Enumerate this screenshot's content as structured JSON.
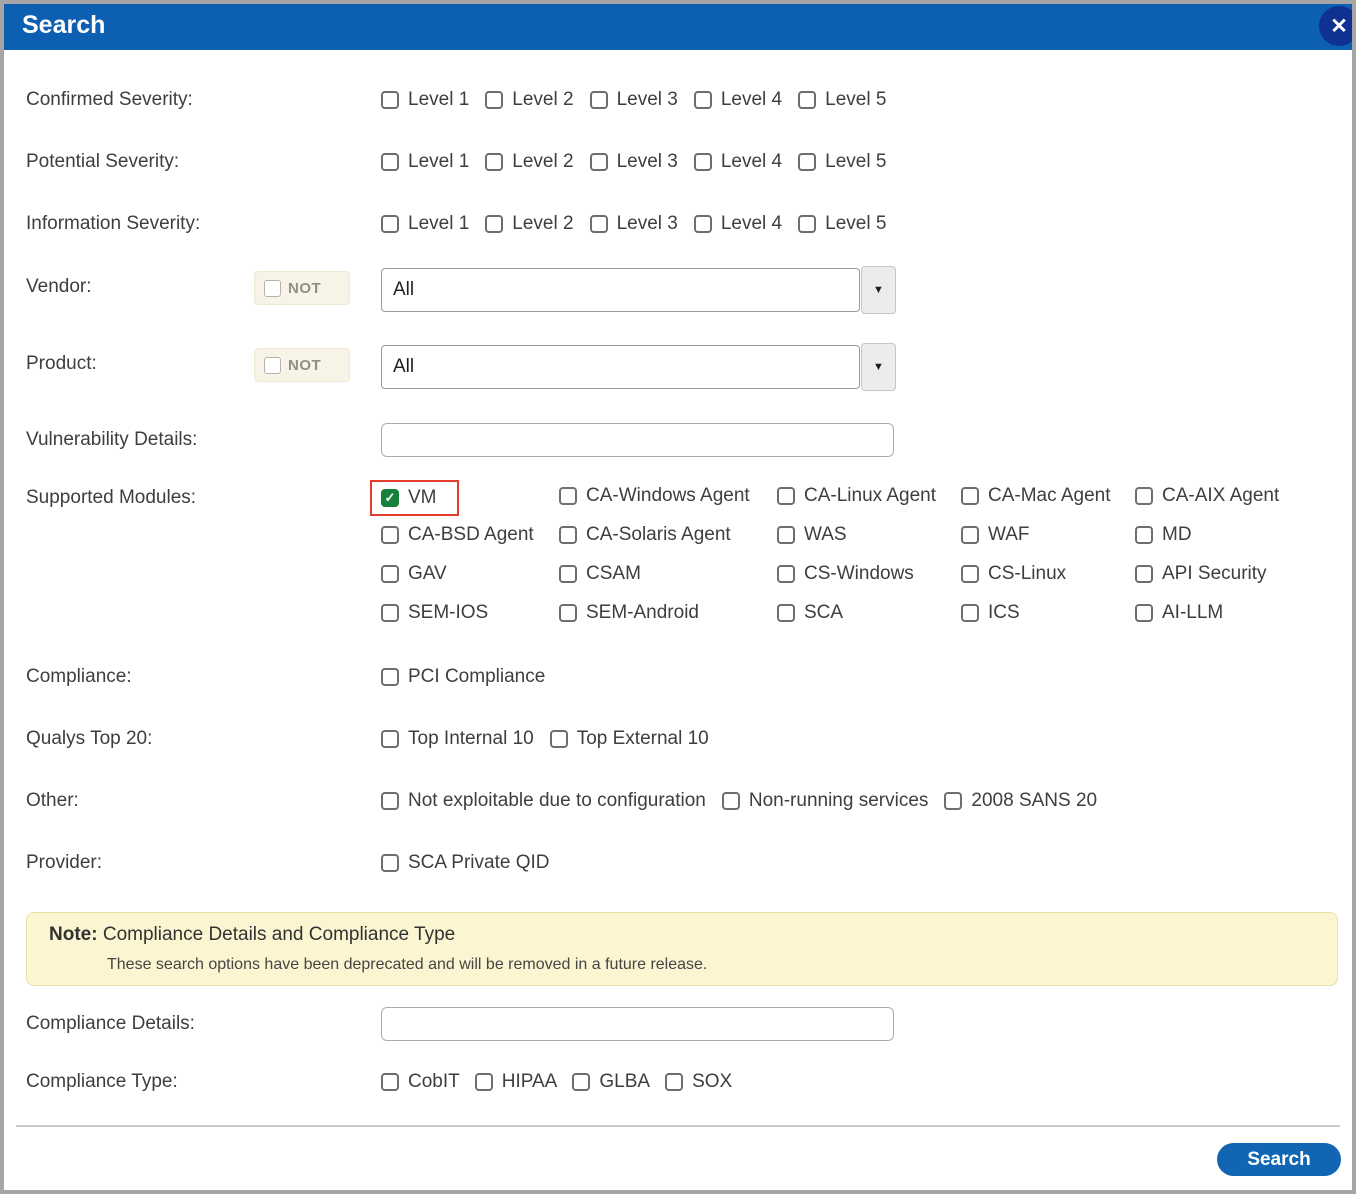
{
  "header": {
    "title": "Search"
  },
  "icons": {
    "close": "✕",
    "check": "✓",
    "dropdown": "▼"
  },
  "labels": {
    "confirmed_severity": "Confirmed Severity:",
    "potential_severity": "Potential Severity:",
    "information_severity": "Information Severity:",
    "vendor": "Vendor:",
    "product": "Product:",
    "vulnerability_details": "Vulnerability Details:",
    "supported_modules": "Supported Modules:",
    "compliance": "Compliance:",
    "qualys_top20": "Qualys Top 20:",
    "other": "Other:",
    "provider": "Provider:",
    "compliance_details": "Compliance Details:",
    "compliance_type": "Compliance Type:"
  },
  "severity_levels": [
    "Level 1",
    "Level 2",
    "Level 3",
    "Level 4",
    "Level 5"
  ],
  "not_label": "NOT",
  "vendor": {
    "not_checked": false,
    "value": "All"
  },
  "product": {
    "not_checked": false,
    "value": "All"
  },
  "vulnerability_details": {
    "value": ""
  },
  "modules": {
    "items": [
      {
        "label": "VM",
        "checked": true,
        "highlighted": true
      },
      {
        "label": "CA-Windows Agent",
        "checked": false
      },
      {
        "label": "CA-Linux Agent",
        "checked": false
      },
      {
        "label": "CA-Mac Agent",
        "checked": false
      },
      {
        "label": "CA-AIX Agent",
        "checked": false
      },
      {
        "label": "CA-BSD Agent",
        "checked": false
      },
      {
        "label": "CA-Solaris Agent",
        "checked": false
      },
      {
        "label": "WAS",
        "checked": false
      },
      {
        "label": "WAF",
        "checked": false
      },
      {
        "label": "MD",
        "checked": false
      },
      {
        "label": "GAV",
        "checked": false
      },
      {
        "label": "CSAM",
        "checked": false
      },
      {
        "label": "CS-Windows",
        "checked": false
      },
      {
        "label": "CS-Linux",
        "checked": false
      },
      {
        "label": "API Security",
        "checked": false
      },
      {
        "label": "SEM-IOS",
        "checked": false
      },
      {
        "label": "SEM-Android",
        "checked": false
      },
      {
        "label": "SCA",
        "checked": false
      },
      {
        "label": "ICS",
        "checked": false
      },
      {
        "label": "AI-LLM",
        "checked": false
      }
    ]
  },
  "compliance_options": [
    "PCI Compliance"
  ],
  "qualys_top20_options": [
    "Top Internal 10",
    "Top External 10"
  ],
  "other_options": [
    "Not exploitable due to configuration",
    "Non-running services",
    "2008 SANS 20"
  ],
  "provider_options": [
    "SCA Private QID"
  ],
  "note": {
    "prefix": "Note:",
    "title": "Compliance Details and Compliance Type",
    "body": "These search options have been deprecated and will be removed in a future release."
  },
  "compliance_details": {
    "value": ""
  },
  "compliance_type_options": [
    "CobIT",
    "HIPAA",
    "GLBA",
    "SOX"
  ],
  "footer": {
    "search_label": "Search"
  },
  "colors": {
    "header_blue": "#0d5fb2",
    "close_circle_blue": "#0f3192",
    "checked_green": "#17813c",
    "highlight_red": "#e43e2b",
    "note_yellow": "#fbf5d1",
    "search_button_blue": "#1165b2"
  }
}
